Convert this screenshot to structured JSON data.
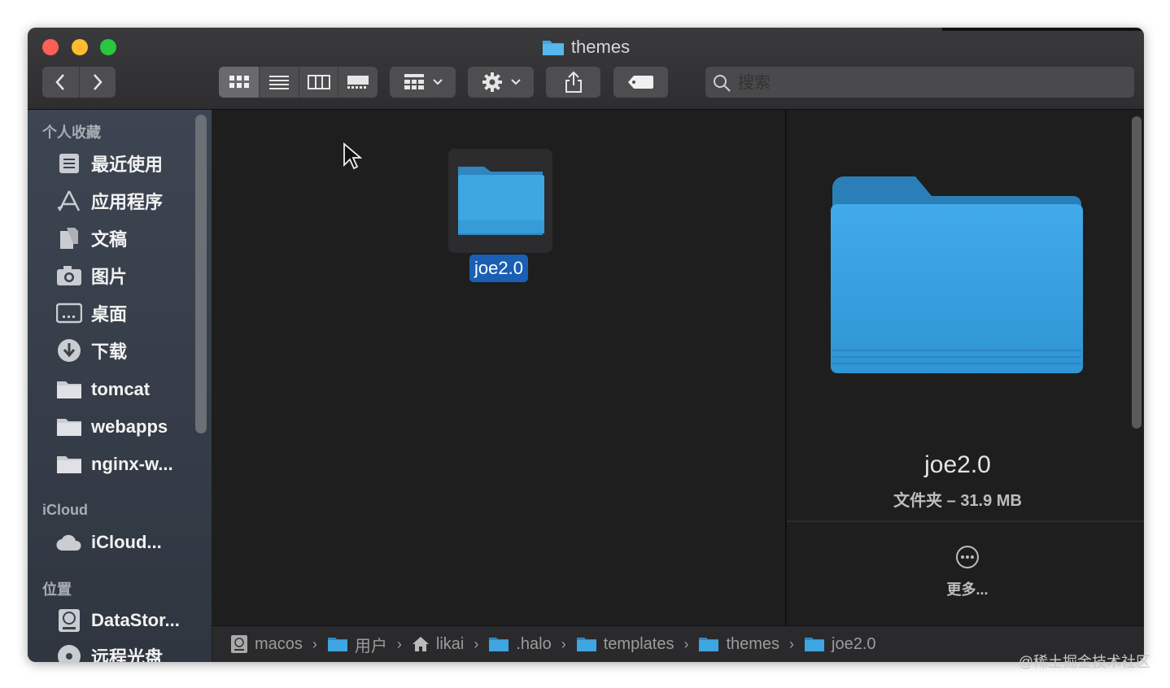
{
  "window": {
    "title": "themes"
  },
  "toolbar": {
    "back": "back",
    "forward": "forward",
    "view_modes": [
      "icon-view",
      "list-view",
      "column-view",
      "gallery-view"
    ],
    "active_view": "icon-view",
    "search_placeholder": "搜索"
  },
  "sidebar": {
    "favorites_header": "个人收藏",
    "favorites": [
      {
        "label": "最近使用",
        "icon": "recents-icon"
      },
      {
        "label": "应用程序",
        "icon": "applications-icon"
      },
      {
        "label": "文稿",
        "icon": "documents-icon"
      },
      {
        "label": "图片",
        "icon": "pictures-icon"
      },
      {
        "label": "桌面",
        "icon": "desktop-icon"
      },
      {
        "label": "下载",
        "icon": "downloads-icon"
      },
      {
        "label": "tomcat",
        "icon": "folder-icon"
      },
      {
        "label": "webapps",
        "icon": "folder-icon"
      },
      {
        "label": "nginx-w...",
        "icon": "folder-icon"
      }
    ],
    "icloud_header": "iCloud",
    "icloud": [
      {
        "label": "iCloud...",
        "icon": "cloud-icon"
      }
    ],
    "locations_header": "位置",
    "locations": [
      {
        "label": "DataStor...",
        "icon": "disk-icon"
      },
      {
        "label": "远程光盘",
        "icon": "disc-icon"
      }
    ]
  },
  "content": {
    "items": [
      {
        "name": "joe2.0",
        "type": "folder",
        "selected": true
      }
    ]
  },
  "preview": {
    "name": "joe2.0",
    "info": "文件夹 – 31.9 MB",
    "more": "更多..."
  },
  "pathbar": {
    "crumbs": [
      {
        "label": "macos",
        "icon": "disk-icon"
      },
      {
        "label": "用户",
        "icon": "folder-icon"
      },
      {
        "label": "likai",
        "icon": "home-icon"
      },
      {
        "label": ".halo",
        "icon": "folder-icon"
      },
      {
        "label": "templates",
        "icon": "folder-icon"
      },
      {
        "label": "themes",
        "icon": "folder-icon"
      },
      {
        "label": "joe2.0",
        "icon": "folder-icon"
      }
    ]
  },
  "watermark": "@稀土掘金技术社区",
  "colors": {
    "folder": "#3ea6e0",
    "selection": "#1a5fb4",
    "sidebar": "#38404b"
  }
}
